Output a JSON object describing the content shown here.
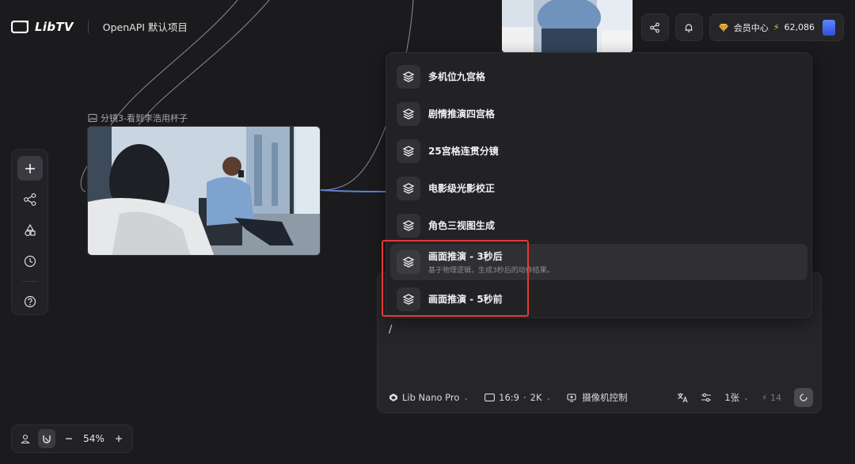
{
  "header": {
    "logo_text": "LibTV",
    "project_name": "OpenAPI 默认项目",
    "member_label": "会员中心",
    "credits": "62,086"
  },
  "node": {
    "title": "分镜3-看到李浩用杯子"
  },
  "menu": {
    "items": [
      {
        "label": "多机位九宫格",
        "desc": ""
      },
      {
        "label": "剧情推演四宫格",
        "desc": ""
      },
      {
        "label": "25宫格连贯分镜",
        "desc": ""
      },
      {
        "label": "电影级光影校正",
        "desc": ""
      },
      {
        "label": "角色三视图生成",
        "desc": ""
      },
      {
        "label": "画面推演 - 3秒后",
        "desc": "基于物理逻辑，生成3秒后的动作结果。"
      },
      {
        "label": "画面推演 - 5秒前",
        "desc": ""
      }
    ]
  },
  "prompt": {
    "text": "/",
    "model": "Lib Nano Pro",
    "aspect": "16:9",
    "resolution": "2K",
    "camera_label": "摄像机控制",
    "count": "1张",
    "cost": "14"
  },
  "zoom": {
    "level": "54%"
  },
  "colors": {
    "background": "#1b1b1d",
    "highlight_box": "#e23a33",
    "credit_bolt": "#f6c844"
  }
}
